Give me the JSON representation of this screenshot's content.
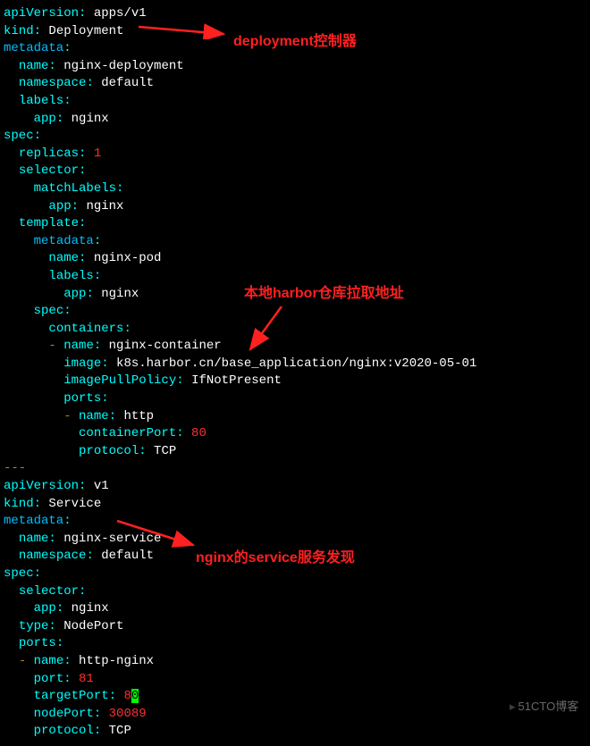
{
  "doc1": {
    "apiVersion_k": "apiVersion",
    "apiVersion_v": "apps/v1",
    "kind_k": "kind",
    "kind_v": "Deployment",
    "metadata_k": "metadata",
    "name_k": "name",
    "name_v": "nginx-deployment",
    "namespace_k": "namespace",
    "namespace_v": "default",
    "labels_k": "labels",
    "app_k": "app",
    "app_v": "nginx",
    "spec_k": "spec",
    "replicas_k": "replicas",
    "replicas_v": "1",
    "selector_k": "selector",
    "matchLabels_k": "matchLabels",
    "ml_app_k": "app",
    "ml_app_v": "nginx",
    "template_k": "template",
    "t_metadata_k": "metadata",
    "t_name_k": "name",
    "t_name_v": "nginx-pod",
    "t_labels_k": "labels",
    "t_app_k": "app",
    "t_app_v": "nginx",
    "t_spec_k": "spec",
    "containers_k": "containers",
    "c_name_k": "name",
    "c_name_v": "nginx-container",
    "image_k": "image",
    "image_v": "k8s.harbor.cn/base_application/nginx:v2020-05-01",
    "ipp_k": "imagePullPolicy",
    "ipp_v": "IfNotPresent",
    "ports_k": "ports",
    "p_name_k": "name",
    "p_name_v": "http",
    "cp_k": "containerPort",
    "cp_v": "80",
    "proto_k": "protocol",
    "proto_v": "TCP"
  },
  "sep": "---",
  "doc2": {
    "apiVersion_k": "apiVersion",
    "apiVersion_v": "v1",
    "kind_k": "kind",
    "kind_v": "Service",
    "metadata_k": "metadata",
    "name_k": "name",
    "name_v": "nginx-service",
    "namespace_k": "namespace",
    "namespace_v": "default",
    "spec_k": "spec",
    "selector_k": "selector",
    "app_k": "app",
    "app_v": "nginx",
    "type_k": "type",
    "type_v": "NodePort",
    "ports_k": "ports",
    "p_name_k": "name",
    "p_name_v": "http-nginx",
    "port_k": "port",
    "port_v": "81",
    "tp_k": "targetPort",
    "tp_v_pre": "8",
    "tp_v_cur": "0",
    "np_k": "nodePort",
    "np_v": "30089",
    "proto_k": "protocol",
    "proto_v": "TCP"
  },
  "annotations": {
    "a1": "deployment控制器",
    "a2": "本地harbor仓库拉取地址",
    "a3": "nginx的service服务发现"
  },
  "watermark": "51CTO博客"
}
